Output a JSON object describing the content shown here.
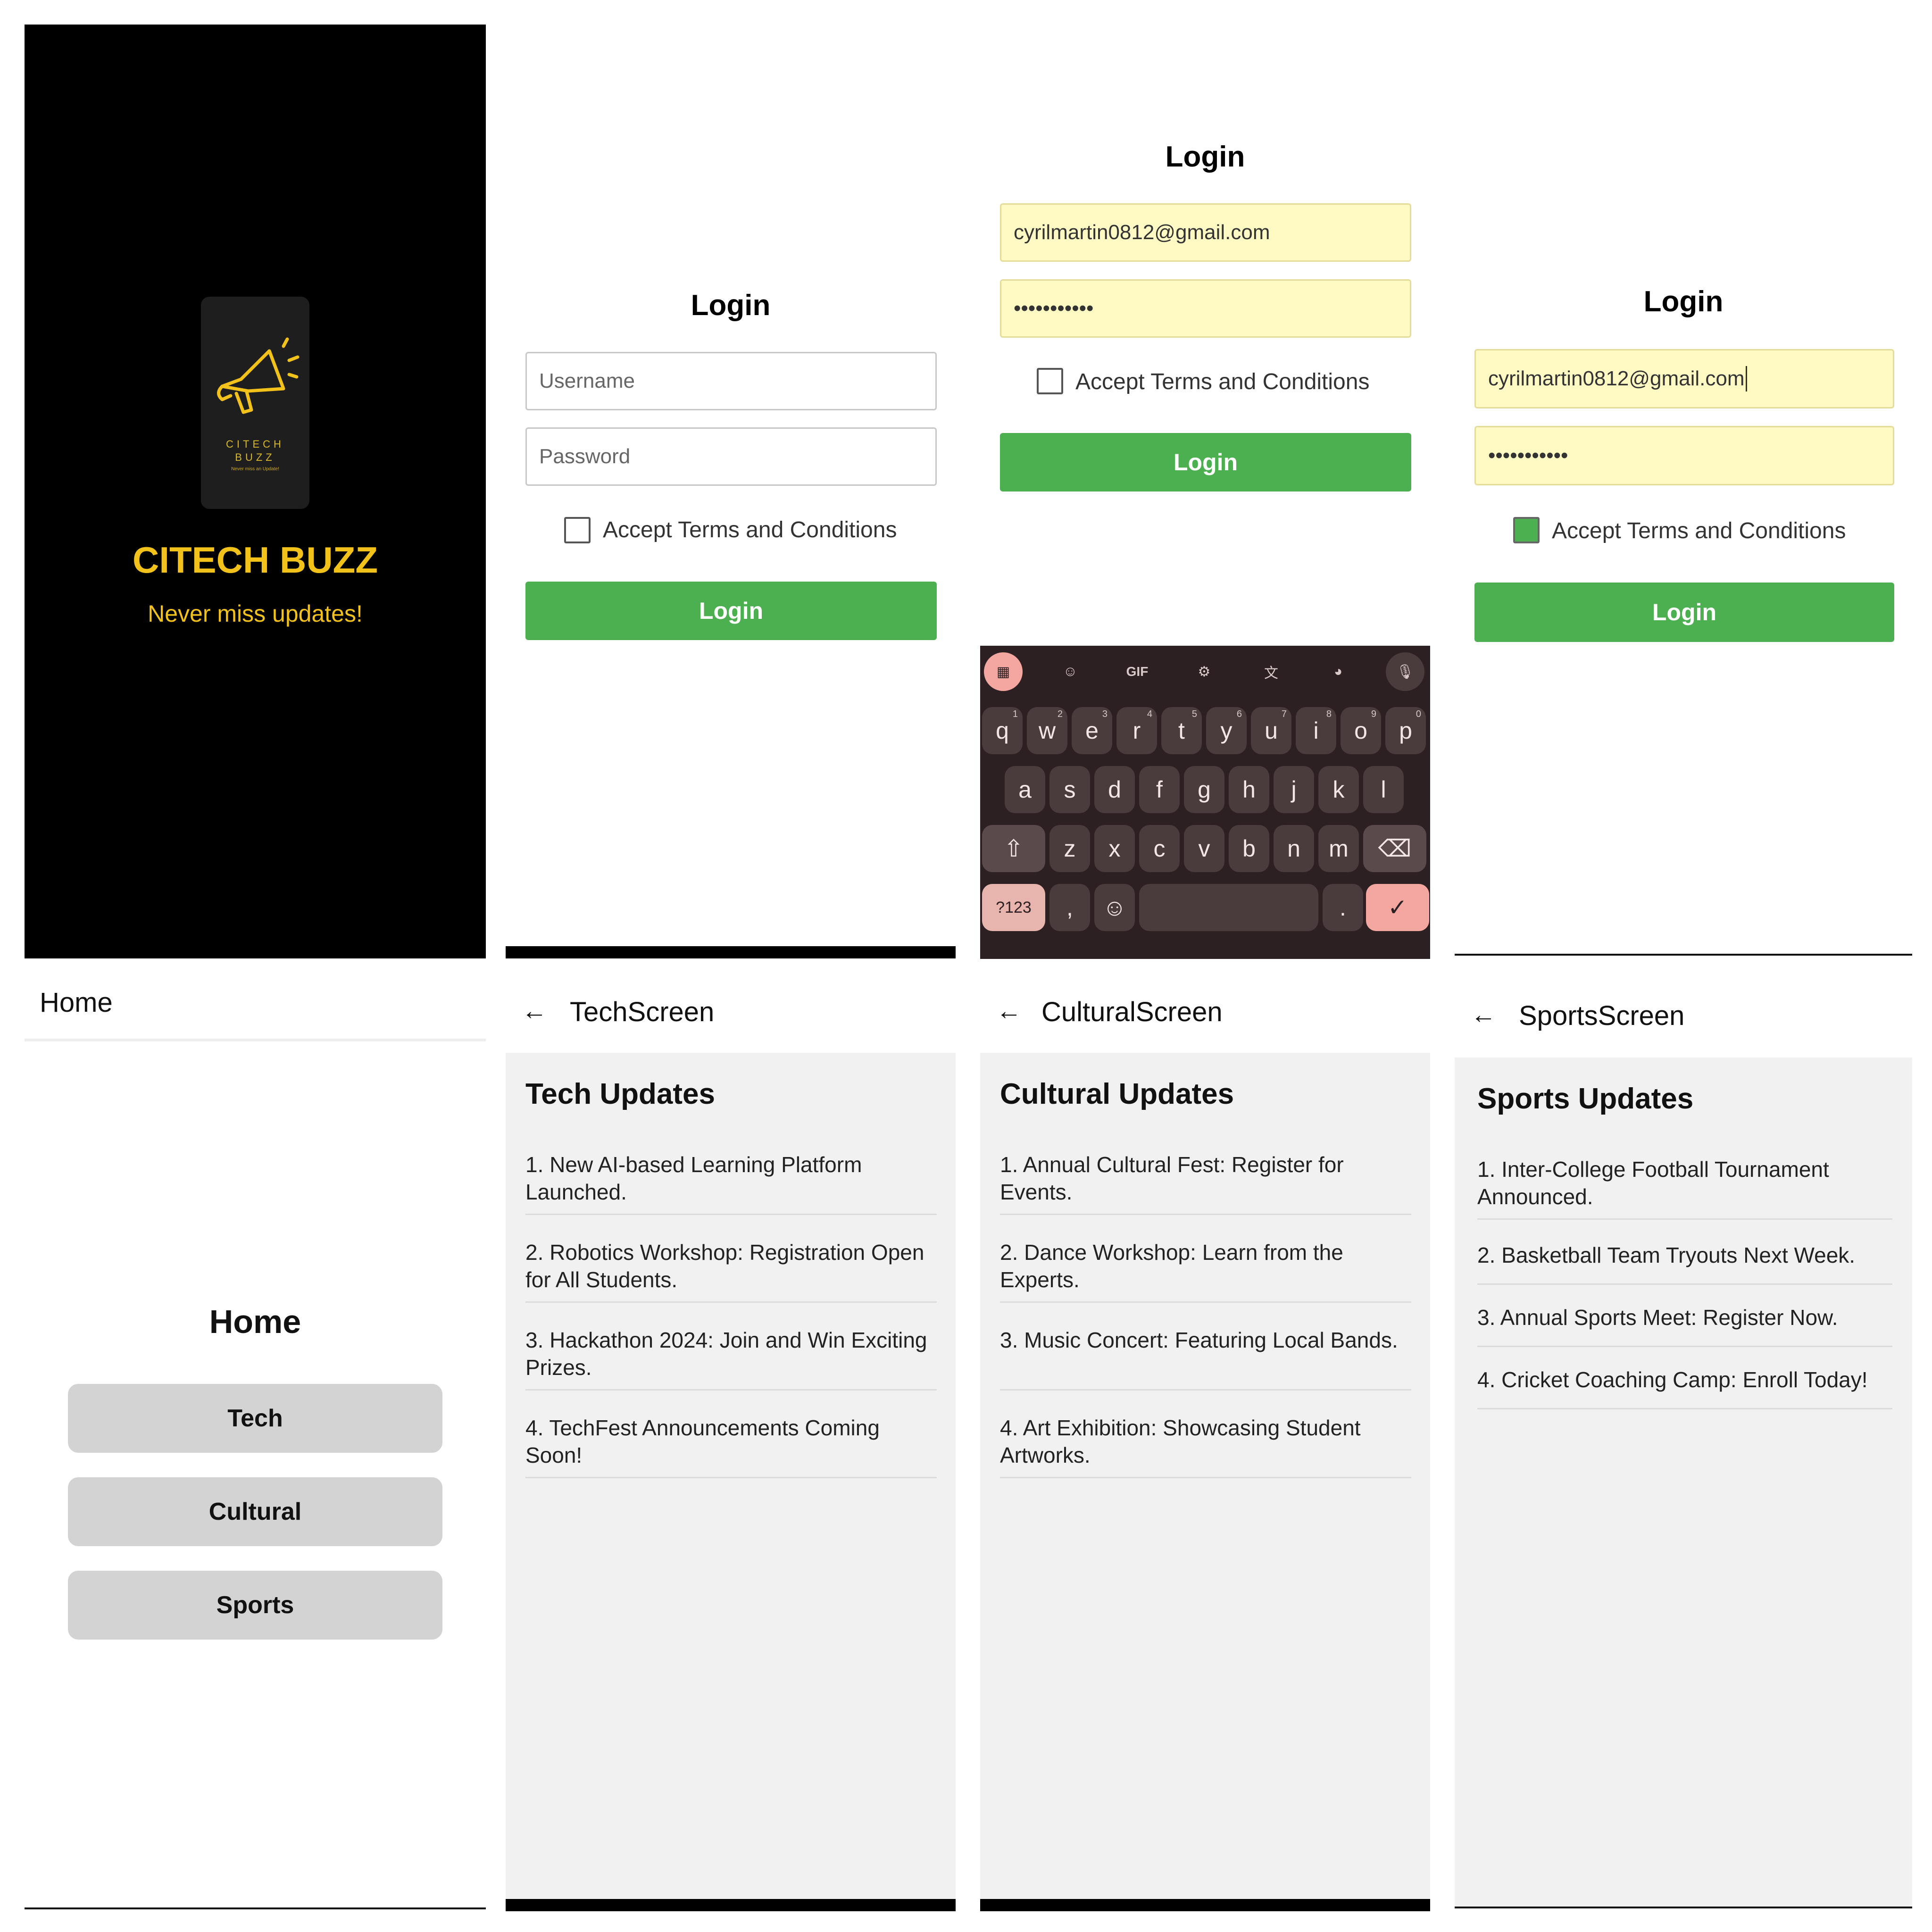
{
  "splash": {
    "logo_line1": "CITECH",
    "logo_line2": "BUZZ",
    "logo_line3": "Never miss an Update!",
    "title": "CITECH BUZZ",
    "tagline": "Never miss updates!",
    "accent": "#f2c21b"
  },
  "login_empty": {
    "title": "Login",
    "username_placeholder": "Username",
    "password_placeholder": "Password",
    "terms_label": "Accept Terms and Conditions",
    "terms_checked": false,
    "button": "Login"
  },
  "login_typing": {
    "title": "Login",
    "email": "cyrilmartin0812@gmail.com",
    "password": "•••••••••••",
    "terms_label": "Accept Terms and Conditions",
    "terms_checked": false,
    "button": "Login"
  },
  "keyboard": {
    "tools": [
      "apps-icon",
      "sticker-icon",
      "GIF",
      "gear-icon",
      "translate-icon",
      "palette-icon",
      "mic-icon"
    ],
    "row1": [
      "q",
      "w",
      "e",
      "r",
      "t",
      "y",
      "u",
      "i",
      "o",
      "p"
    ],
    "row1_nums": [
      "1",
      "2",
      "3",
      "4",
      "5",
      "6",
      "7",
      "8",
      "9",
      "0"
    ],
    "row2": [
      "a",
      "s",
      "d",
      "f",
      "g",
      "h",
      "j",
      "k",
      "l"
    ],
    "row3": [
      "z",
      "x",
      "c",
      "v",
      "b",
      "n",
      "m"
    ],
    "sym_key": "?123",
    "comma": ",",
    "period": "."
  },
  "login_checked": {
    "title": "Login",
    "email": "cyrilmartin0812@gmail.com",
    "password": "•••••••••••",
    "terms_label": "Accept Terms and Conditions",
    "terms_checked": true,
    "button": "Login"
  },
  "home": {
    "appbar_title": "Home",
    "heading": "Home",
    "buttons": [
      "Tech",
      "Cultural",
      "Sports"
    ]
  },
  "tech": {
    "appbar_title": "TechScreen",
    "heading": "Tech Updates",
    "items": [
      "1. New AI-based Learning Platform Launched.",
      "2. Robotics Workshop: Registration Open for All Students.",
      "3. Hackathon 2024: Join and Win Exciting Prizes.",
      "4. TechFest Announcements Coming Soon!"
    ]
  },
  "cultural": {
    "appbar_title": "CulturalScreen",
    "heading": "Cultural Updates",
    "items": [
      "1. Annual Cultural Fest: Register for Events.",
      "2. Dance Workshop: Learn from the Experts.",
      "3. Music Concert: Featuring Local Bands.",
      "4. Art Exhibition: Showcasing Student Artworks."
    ]
  },
  "sports": {
    "appbar_title": "SportsScreen",
    "heading": "Sports Updates",
    "items": [
      "1. Inter-College Football Tournament Announced.",
      "2. Basketball Team Tryouts Next Week.",
      "3. Annual Sports Meet: Register Now.",
      "4. Cricket Coaching Camp: Enroll Today!"
    ]
  },
  "colors": {
    "green": "#4caf50",
    "filled_field": "#fff9c4",
    "keyboard_bg": "#2d2022",
    "action_key": "#f4a7a0"
  }
}
